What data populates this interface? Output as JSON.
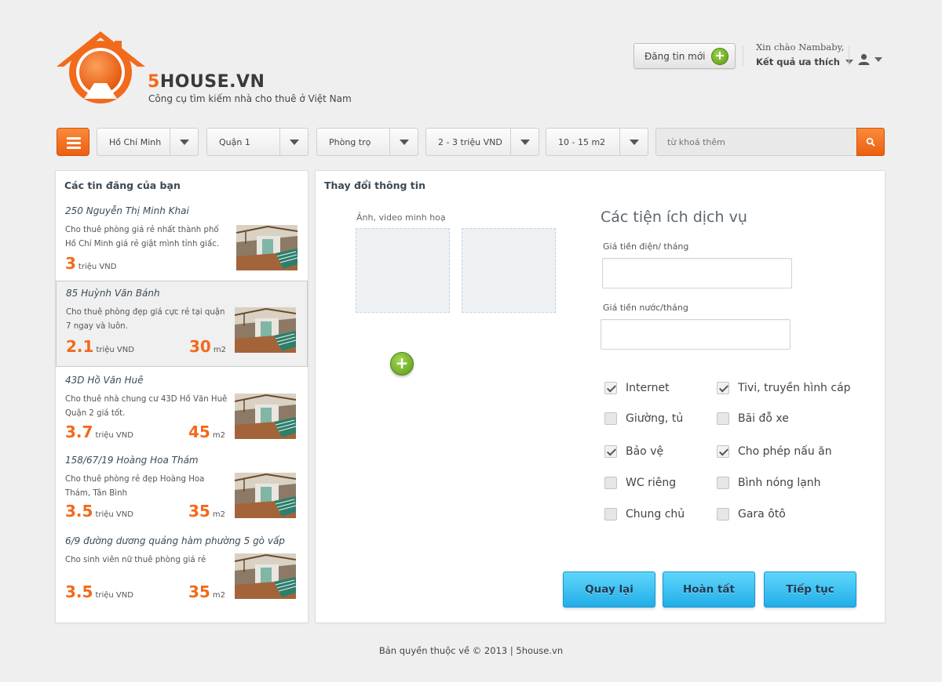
{
  "header": {
    "brand_prefix": "5",
    "brand_suffix": "HOUSE.VN",
    "tagline": "Công cụ tìm kiếm nhà cho thuê ở Việt Nam",
    "post_button": "Đăng tin mới",
    "greeting": "Xin chào Nambaby,",
    "favorites": "Kết quả ưa thích",
    "accent_color": "#f26a1b"
  },
  "filters": {
    "city": "Hồ Chí Minh",
    "district": "Quận 1",
    "type": "Phòng trọ",
    "price": "2 - 3 triệu VND",
    "area": "10 - 15 m2",
    "search_placeholder": "từ khoá thêm"
  },
  "sidebar": {
    "title": "Các tin đăng của bạn",
    "listings": [
      {
        "title": "250 Nguyễn Thị Minh Khai",
        "desc": "Cho thuê phòng giá rẻ nhất thành phố Hồ Chí Minh giá rẻ giật mình tỉnh giấc.",
        "price": "3",
        "price_unit": "triệu VND",
        "area": "",
        "area_unit": ""
      },
      {
        "title": "85 Huỳnh Văn Bánh",
        "desc": "Cho thuê phòng đẹp giá cực rẻ tại quận 7 ngay và luôn.",
        "price": "2.1",
        "price_unit": "triệu VND",
        "area": "30",
        "area_unit": "m2",
        "selected": true
      },
      {
        "title": "43D Hồ Văn Huê",
        "desc": "Cho thuê nhà chung cư 43D Hồ Văn Huê Quận 2 giá tốt.",
        "price": "3.7",
        "price_unit": "triệu VND",
        "area": "45",
        "area_unit": "m2"
      },
      {
        "title": "158/67/19 Hoàng Hoa Thám",
        "desc": "Cho thuê phòng rẻ đẹp Hoàng Hoa Thám, Tân Bình",
        "price": "3.5",
        "price_unit": "triệu VND",
        "area": "35",
        "area_unit": "m2"
      },
      {
        "title": "6/9 đường dương quảng hàm phường 5 gò vấp",
        "desc": "Cho sinh viên nữ thuê phòng giá rẻ",
        "price": "3.5",
        "price_unit": "triệu VND",
        "area": "35",
        "area_unit": "m2"
      }
    ]
  },
  "main": {
    "title": "Thay đổi thông tin",
    "media_label": "Ảnh, video minh hoạ",
    "services_title": "Các tiện ích dịch vụ",
    "electric_label": "Giá tiền điện/ tháng",
    "water_label": "Giá tiền nước/tháng",
    "amenities": [
      {
        "label": "Internet",
        "checked": true
      },
      {
        "label": "Tivi, truyền hình cáp",
        "checked": true
      },
      {
        "label": "Giường, tủ",
        "checked": false
      },
      {
        "label": "Bãi đỗ xe",
        "checked": false
      },
      {
        "label": "Bảo vệ",
        "checked": true
      },
      {
        "label": "Cho phép nấu ăn",
        "checked": true
      },
      {
        "label": "WC riêng",
        "checked": false
      },
      {
        "label": "Bình nóng lạnh",
        "checked": false
      },
      {
        "label": "Chung chủ",
        "checked": false
      },
      {
        "label": "Gara ôtô",
        "checked": false
      }
    ],
    "buttons": {
      "back": "Quay lại",
      "finish": "Hoàn tất",
      "next": "Tiếp tục"
    }
  },
  "footer": {
    "text": "Bản quyền thuộc về © 2013 | 5house.vn"
  }
}
